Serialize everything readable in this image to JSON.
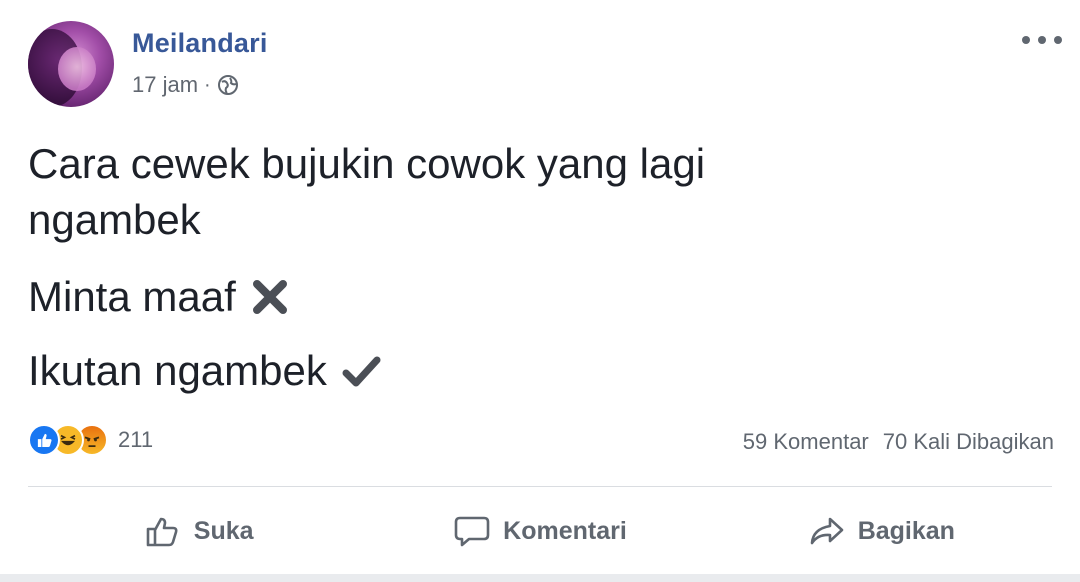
{
  "post": {
    "author": "Meilandari",
    "time": "17 jam",
    "separator": "·",
    "privacy_icon": "globe-icon",
    "more_icon": "more-options-icon",
    "text": {
      "line1": "Cara cewek bujukin cowok yang lagi",
      "line2": "ngambek",
      "line3": "Minta maaf",
      "line3_mark": "x-mark-icon",
      "line4": "Ikutan ngambek",
      "line4_mark": "check-mark-icon"
    },
    "reactions": {
      "icons": [
        "like-reaction-icon",
        "haha-reaction-icon",
        "angry-reaction-icon"
      ],
      "count": "211"
    },
    "stats": {
      "comments": "59 Komentar",
      "shares": "70 Kali Dibagikan"
    },
    "actions": {
      "like": "Suka",
      "comment": "Komentari",
      "share": "Bagikan"
    },
    "colors": {
      "author": "#385898",
      "meta": "#616770",
      "like_blue": "#1877f2",
      "haha_yellow": "#f7b928"
    }
  }
}
